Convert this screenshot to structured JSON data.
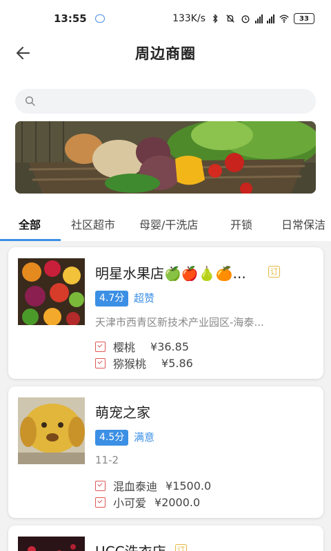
{
  "status": {
    "time": "13:55",
    "speed": "133K/s",
    "battery": "33"
  },
  "header": {
    "title": "周边商圈"
  },
  "search": {
    "placeholder": ""
  },
  "tabs": [
    "全部",
    "社区超市",
    "母婴/干洗店",
    "开锁",
    "日常保洁"
  ],
  "shops": [
    {
      "name": "明星水果店🍏🍎🍐🍊...",
      "tag": "订",
      "score": "4.7分",
      "score_text": "超赞",
      "address": "天津市西青区新技术产业园区-海泰...",
      "items": [
        {
          "name": "樱桃",
          "price": "¥36.85"
        },
        {
          "name": "猕猴桃",
          "price": "¥5.86"
        }
      ]
    },
    {
      "name": "萌宠之家",
      "score": "4.5分",
      "score_text": "满意",
      "address": "11-2",
      "items": [
        {
          "name": "混血泰迪",
          "price": "¥1500.0"
        },
        {
          "name": "小可爱",
          "price": "¥2000.0"
        }
      ]
    },
    {
      "name": "UCC洗衣店",
      "tag": "订"
    }
  ],
  "colors": {
    "accent": "#3b8fe4",
    "tag": "#e5b63c",
    "item_icon": "#e05555"
  }
}
